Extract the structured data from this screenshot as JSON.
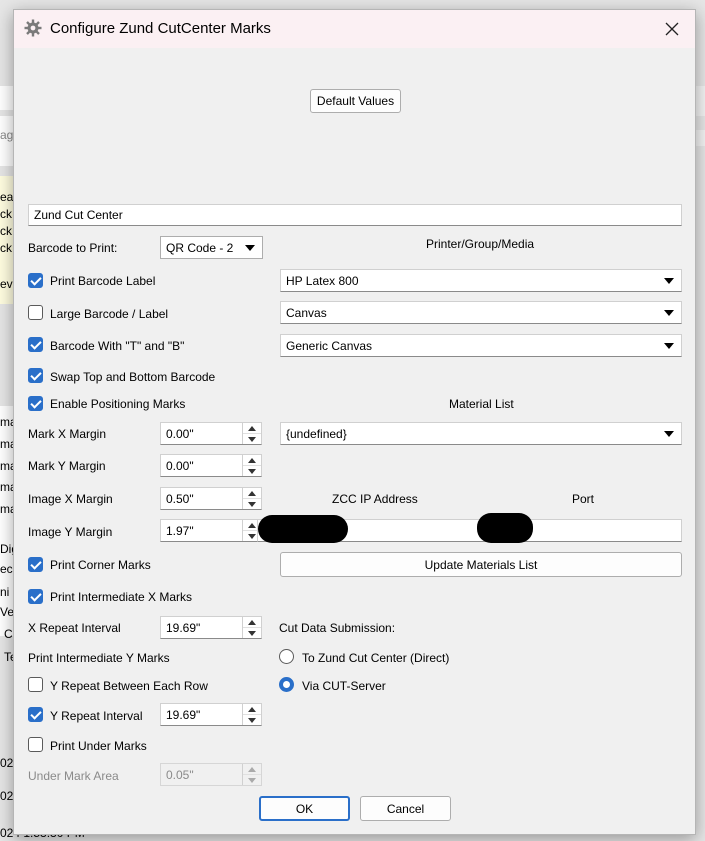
{
  "dialog": {
    "title": "Configure Zund CutCenter Marks",
    "default_values_label": "Default Values",
    "name_value": "Zund Cut Center",
    "barcode_to_print_label": "Barcode to Print:",
    "barcode_to_print_value": "QR Code - 2",
    "printer_group_media_label": "Printer/Group/Media",
    "printer_value": "HP Latex 800",
    "group_value": "Canvas",
    "media_value": "Generic Canvas",
    "material_list_label": "Material List",
    "material_value": "{undefined}",
    "zcc_ip_label": "ZCC IP Address",
    "port_label": "Port",
    "update_materials_label": "Update Materials List",
    "cut_data_submission_label": "Cut Data Submission:",
    "radio_direct_label": "To Zund Cut Center (Direct)",
    "radio_cutserver_label": "Via CUT-Server",
    "ok_label": "OK",
    "cancel_label": "Cancel",
    "checkboxes": {
      "print_barcode_label": {
        "label": "Print Barcode Label",
        "checked": true
      },
      "large_barcode": {
        "label": "Large Barcode / Label",
        "checked": false
      },
      "barcode_t_b": {
        "label": "Barcode With \"T\" and \"B\"",
        "checked": true
      },
      "swap_top_bottom": {
        "label": "Swap Top and Bottom Barcode",
        "checked": true
      },
      "enable_positioning": {
        "label": "Enable Positioning Marks",
        "checked": true
      },
      "print_corner": {
        "label": "Print Corner Marks",
        "checked": true
      },
      "print_intermediate_x": {
        "label": "Print Intermediate X Marks",
        "checked": true
      },
      "y_repeat_each_row": {
        "label": "Y Repeat Between Each Row",
        "checked": false
      },
      "y_repeat_interval": {
        "label": "Y Repeat Interval",
        "checked": true
      },
      "print_under_marks": {
        "label": "Print Under Marks",
        "checked": false
      }
    },
    "fields": {
      "mark_x_margin": {
        "label": "Mark X Margin",
        "value": "0.00\""
      },
      "mark_y_margin": {
        "label": "Mark Y Margin",
        "value": "0.00\""
      },
      "image_x_margin": {
        "label": "Image X Margin",
        "value": "0.50\""
      },
      "image_y_margin": {
        "label": "Image Y Margin",
        "value": "1.97\""
      },
      "x_repeat_interval": {
        "label": "X Repeat Interval",
        "value": "19.69\""
      },
      "y_repeat_interval_value": "19.69\"",
      "under_mark_area": {
        "label": "Under Mark Area",
        "value": "0.05\""
      }
    },
    "print_intermediate_y_label": "Print Intermediate Y Marks"
  },
  "background": {
    "left_fragments": [
      "ag",
      "ea",
      "ck",
      "ck",
      "ck",
      "eve",
      "ma",
      "ma",
      "ma",
      "ma",
      "ma",
      "Dig",
      "ec",
      "ni",
      "Ve",
      "C",
      "Te",
      "02",
      "02"
    ],
    "bottom_text": "024 1:53:30 PM"
  },
  "colors": {
    "accent": "#2a6fc9",
    "title_bar": "#fbf0f3",
    "dialog_bg": "#f0f0f0"
  }
}
